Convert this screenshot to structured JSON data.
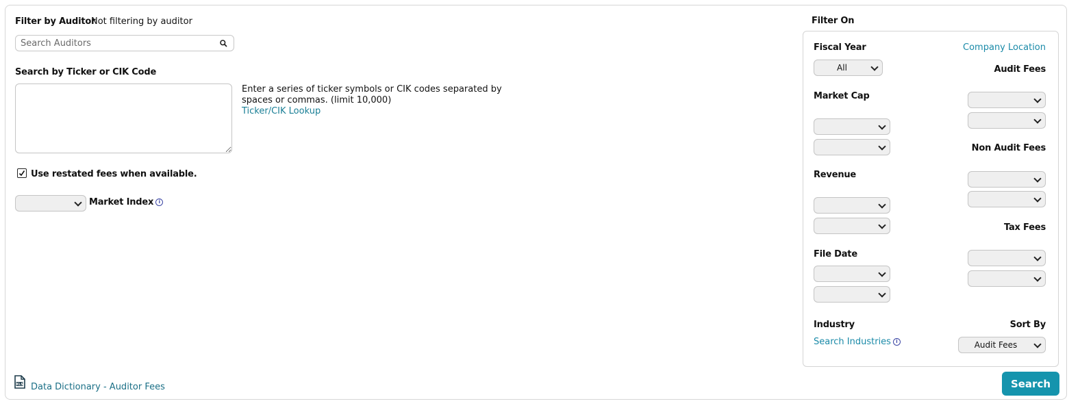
{
  "auditor_filter": {
    "label": "Filter by Auditor",
    "status": "Not filtering by auditor",
    "search_placeholder": "Search Auditors"
  },
  "ticker_search": {
    "label": "Search by Ticker or CIK Code",
    "textarea_value": "",
    "help_line1": "Enter a series of ticker symbols or CIK codes separated by",
    "help_line2": "spaces or commas. (limit 10,000)",
    "lookup_link": "Ticker/CIK Lookup"
  },
  "restated": {
    "checked": true,
    "label": "Use restated fees when available."
  },
  "market_index": {
    "value": "",
    "label": "Market Index"
  },
  "filter_on": {
    "title": "Filter On",
    "fiscal_year_label": "Fiscal Year",
    "fiscal_year_value": "All",
    "company_location_link": "Company Location",
    "audit_fees_label": "Audit Fees",
    "market_cap_label": "Market Cap",
    "non_audit_fees_label": "Non Audit Fees",
    "revenue_label": "Revenue",
    "tax_fees_label": "Tax Fees",
    "file_date_label": "File Date",
    "industry_label": "Industry",
    "search_industries_link": "Search Industries",
    "sort_by_label": "Sort By",
    "sort_by_value": "Audit Fees"
  },
  "footer": {
    "dictionary_link": "Data Dictionary - Auditor Fees",
    "search_button": "Search"
  },
  "colors": {
    "accent": "#1594ad",
    "link": "#1a8aa8"
  }
}
